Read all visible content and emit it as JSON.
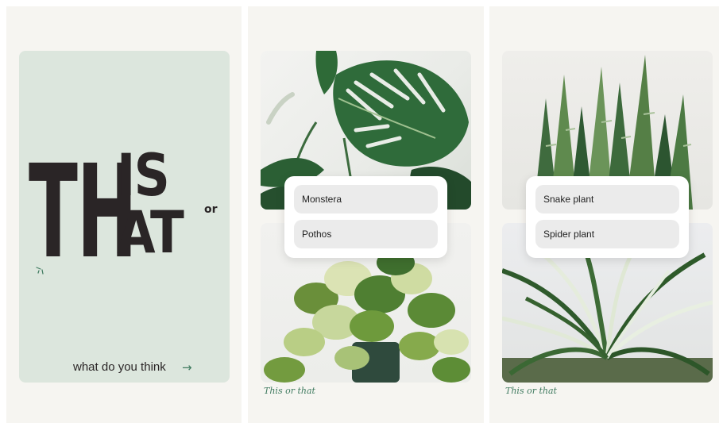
{
  "cover": {
    "title_big": "TH",
    "title_top": "IS",
    "title_bottom": "AT",
    "title_or": "or",
    "footer_text": "what do you think",
    "footer_arrow": "→"
  },
  "slides": [
    {
      "options": [
        "Monstera",
        "Pothos"
      ],
      "brand": "This or that"
    },
    {
      "options": [
        "Snake plant",
        "Spider plant"
      ],
      "brand": "This or that"
    }
  ],
  "colors": {
    "cover_background": "#dce6dd",
    "title": "#2a2526",
    "accent_green": "#3f7a5f",
    "option_background": "#ebebeb"
  }
}
